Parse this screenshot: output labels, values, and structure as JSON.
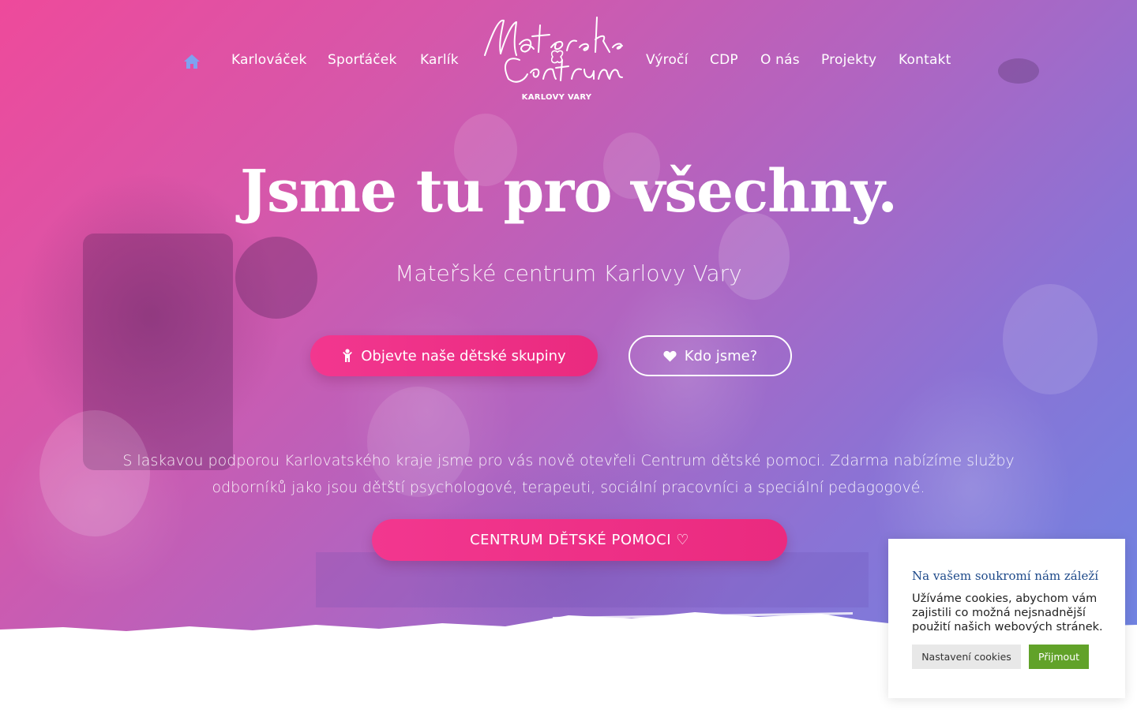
{
  "nav": {
    "home_icon": "home-icon",
    "items_left": [
      "Karlováček",
      "Sporťáček",
      "Karlík"
    ],
    "items_right": [
      "Výročí",
      "CDP",
      "O nás",
      "Projekty",
      "Kontakt"
    ],
    "logo_subtitle": "KARLOVY VARY"
  },
  "hero": {
    "headline": "Jsme tu pro všechny.",
    "subtitle": "Mateřské centrum Karlovy Vary",
    "btn_groups_label": "Objevte naše dětské skupiny",
    "btn_groups_icon": "child-icon",
    "btn_about_label": "Kdo jsme?",
    "btn_about_icon": "heart-icon",
    "info_text": "S laskavou podporou Karlovatského kraje jsme pro vás nově otevřeli Centrum dětské pomoci. Zdarma nabízíme služby odborníků jako jsou dětští psychologové, terapeuti, sociální pracovníci a speciální pedagogové.",
    "btn_cdp_label": "CENTRUM DĚTSKÉ POMOCI ♡"
  },
  "cookie": {
    "title": "Na vašem soukromí nám záleží",
    "text": "Užíváme cookies, abychom vám zajistili co možná nejsnadnější použití našich webových stránek.",
    "settings_label": "Nastavení cookies",
    "accept_label": "Přijmout"
  },
  "colors": {
    "gradient_start": "#ee4a9b",
    "gradient_end": "#6f84e2",
    "primary_button": "#f2378f",
    "cookie_title": "#1e4a8a",
    "cookie_accept": "#61a229"
  }
}
